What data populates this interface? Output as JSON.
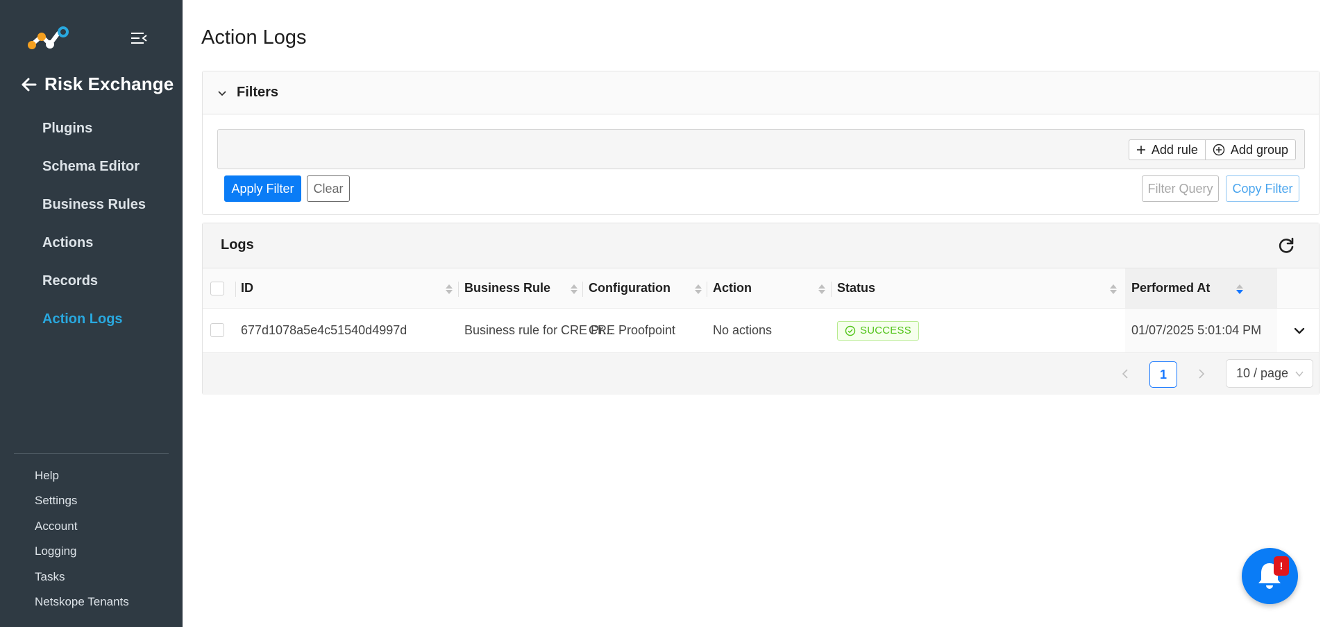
{
  "sidebar": {
    "module_title": "Risk Exchange",
    "items": [
      {
        "label": "Plugins"
      },
      {
        "label": "Schema Editor"
      },
      {
        "label": "Business Rules"
      },
      {
        "label": "Actions"
      },
      {
        "label": "Records"
      },
      {
        "label": "Action Logs",
        "active": true
      }
    ],
    "bottom_items": [
      {
        "label": "Help"
      },
      {
        "label": "Settings"
      },
      {
        "label": "Account"
      },
      {
        "label": "Logging"
      },
      {
        "label": "Tasks"
      },
      {
        "label": "Netskope Tenants"
      }
    ]
  },
  "page": {
    "title": "Action Logs"
  },
  "filters": {
    "title": "Filters",
    "add_rule": "Add rule",
    "add_group": "Add group",
    "apply_label": "Apply Filter",
    "clear_label": "Clear",
    "filter_query_label": "Filter Query",
    "copy_filter_label": "Copy Filter"
  },
  "logs": {
    "title": "Logs",
    "columns": [
      "ID",
      "Business Rule",
      "Configuration",
      "Action",
      "Status",
      "Performed At"
    ],
    "sorted_column": "Performed At",
    "sort_direction": "descending",
    "rows": [
      {
        "id": "677d1078a5e4c51540d4997d",
        "business_rule": "Business rule for CRE Pr...",
        "configuration": "CRE Proofpoint",
        "action": "No actions",
        "status": "SUCCESS",
        "performed_at": "01/07/2025 5:01:04 PM"
      }
    ]
  },
  "pagination": {
    "current_page": "1",
    "page_size": "10 / page"
  },
  "notification": {
    "badge": "!"
  },
  "colors": {
    "sidebar_bg": "#2f3a43",
    "active_nav": "#29a8df",
    "primary": "#0a7cf6",
    "success": "#52c41a",
    "logo_orange": "#f5a020",
    "logo_blue": "#29a8df"
  }
}
